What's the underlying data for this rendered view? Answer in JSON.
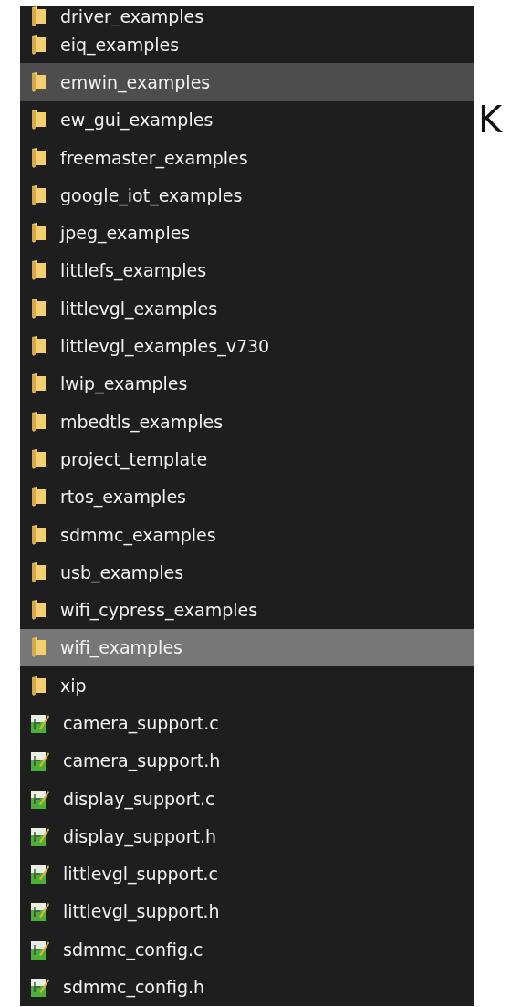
{
  "files": [
    {
      "name": "driver_examples",
      "kind": "folder",
      "selected": false,
      "hovered": false
    },
    {
      "name": "eiq_examples",
      "kind": "folder",
      "selected": false,
      "hovered": false
    },
    {
      "name": "emwin_examples",
      "kind": "folder",
      "selected": false,
      "hovered": true
    },
    {
      "name": "ew_gui_examples",
      "kind": "folder",
      "selected": false,
      "hovered": false
    },
    {
      "name": "freemaster_examples",
      "kind": "folder",
      "selected": false,
      "hovered": false
    },
    {
      "name": "google_iot_examples",
      "kind": "folder",
      "selected": false,
      "hovered": false
    },
    {
      "name": "jpeg_examples",
      "kind": "folder",
      "selected": false,
      "hovered": false
    },
    {
      "name": "littlefs_examples",
      "kind": "folder",
      "selected": false,
      "hovered": false
    },
    {
      "name": "littlevgl_examples",
      "kind": "folder",
      "selected": false,
      "hovered": false
    },
    {
      "name": "littlevgl_examples_v730",
      "kind": "folder",
      "selected": false,
      "hovered": false
    },
    {
      "name": "lwip_examples",
      "kind": "folder",
      "selected": false,
      "hovered": false
    },
    {
      "name": "mbedtls_examples",
      "kind": "folder",
      "selected": false,
      "hovered": false
    },
    {
      "name": "project_template",
      "kind": "folder",
      "selected": false,
      "hovered": false
    },
    {
      "name": "rtos_examples",
      "kind": "folder",
      "selected": false,
      "hovered": false
    },
    {
      "name": "sdmmc_examples",
      "kind": "folder",
      "selected": false,
      "hovered": false
    },
    {
      "name": "usb_examples",
      "kind": "folder",
      "selected": false,
      "hovered": false
    },
    {
      "name": "wifi_cypress_examples",
      "kind": "folder",
      "selected": false,
      "hovered": false
    },
    {
      "name": "wifi_examples",
      "kind": "folder",
      "selected": true,
      "hovered": false
    },
    {
      "name": "xip",
      "kind": "folder",
      "selected": false,
      "hovered": false
    },
    {
      "name": "camera_support.c",
      "kind": "source",
      "selected": false,
      "hovered": false
    },
    {
      "name": "camera_support.h",
      "kind": "source",
      "selected": false,
      "hovered": false
    },
    {
      "name": "display_support.c",
      "kind": "source",
      "selected": false,
      "hovered": false
    },
    {
      "name": "display_support.h",
      "kind": "source",
      "selected": false,
      "hovered": false
    },
    {
      "name": "littlevgl_support.c",
      "kind": "source",
      "selected": false,
      "hovered": false
    },
    {
      "name": "littlevgl_support.h",
      "kind": "source",
      "selected": false,
      "hovered": false
    },
    {
      "name": "sdmmc_config.c",
      "kind": "source",
      "selected": false,
      "hovered": false
    },
    {
      "name": "sdmmc_config.h",
      "kind": "source",
      "selected": false,
      "hovered": false
    }
  ],
  "side_letter": "K"
}
